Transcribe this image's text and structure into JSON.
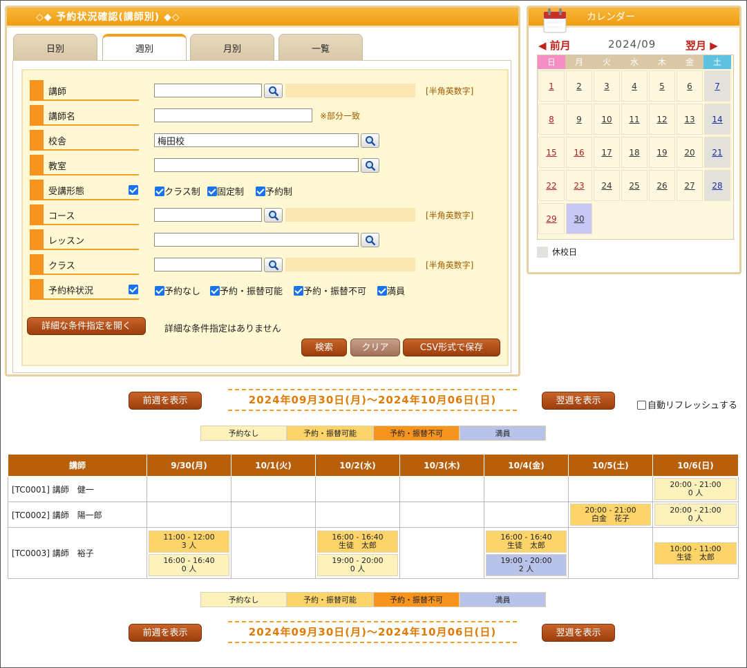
{
  "search": {
    "title": "◇◆ 予約状況確認(講師別) ◆◇",
    "tabs": [
      "日別",
      "週別",
      "月別",
      "一覧"
    ],
    "active_tab": "週別",
    "rows": {
      "teacher": {
        "label": "講師",
        "value": "",
        "hint": "[半角英数字]"
      },
      "teacher_name": {
        "label": "講師名",
        "value": "",
        "hint": "※部分一致"
      },
      "school": {
        "label": "校舎",
        "value": "梅田校"
      },
      "room": {
        "label": "教室",
        "value": ""
      },
      "attend_type": {
        "label": "受講形態",
        "options": [
          "クラス制",
          "固定制",
          "予約制"
        ]
      },
      "course": {
        "label": "コース",
        "value": "",
        "hint": "[半角英数字]"
      },
      "lesson": {
        "label": "レッスン",
        "value": ""
      },
      "class": {
        "label": "クラス",
        "value": "",
        "hint": "[半角英数字]"
      },
      "slot_status": {
        "label": "予約枠状況",
        "options": [
          "予約なし",
          "予約・振替可能",
          "予約・振替不可",
          "満員"
        ]
      }
    },
    "detail_button": "詳細な条件指定を開く",
    "detail_note": "詳細な条件指定はありません",
    "buttons": {
      "search": "検索",
      "clear": "クリア",
      "csv": "CSV形式で保存"
    }
  },
  "calendar": {
    "title": "カレンダー",
    "prev": "前月",
    "next": "翌月",
    "month": "2024/09",
    "dow": [
      "日",
      "月",
      "火",
      "水",
      "木",
      "金",
      "土"
    ],
    "dow_colors": [
      "#f58fc3",
      "#d9c7a5",
      "#d9c7a5",
      "#d9c7a5",
      "#d9c7a5",
      "#d9c7a5",
      "#5fc2e0"
    ],
    "days": [
      "1",
      "2",
      "3",
      "4",
      "5",
      "6",
      "7",
      "8",
      "9",
      "10",
      "11",
      "12",
      "13",
      "14",
      "15",
      "16",
      "17",
      "18",
      "19",
      "20",
      "21",
      "22",
      "23",
      "24",
      "25",
      "26",
      "27",
      "28",
      "29",
      "30"
    ],
    "red_days": [
      "1",
      "8",
      "15",
      "16",
      "22",
      "23",
      "29"
    ],
    "today": "30",
    "legend": "休校日"
  },
  "week": {
    "prev_button": "前週を表示",
    "next_button": "翌週を表示",
    "range": "2024年09月30日(月)～2024年10月06日(日)",
    "auto_refresh": "自動リフレッシュする"
  },
  "legend": [
    {
      "label": "予約なし",
      "color": "#fdf2bc"
    },
    {
      "label": "予約・振替可能",
      "color": "#fdd46a"
    },
    {
      "label": "予約・振替不可",
      "color": "#f7941e"
    },
    {
      "label": "満員",
      "color": "#b8c3ea"
    }
  ],
  "schedule": {
    "headers": [
      "講師",
      "9/30(月)",
      "10/1(火)",
      "10/2(水)",
      "10/3(木)",
      "10/4(金)",
      "10/5(土)",
      "10/6(日)"
    ],
    "rows": [
      {
        "teacher": "[TC0001] 講師　健一",
        "cells": [
          [],
          [],
          [],
          [],
          [],
          [],
          [
            {
              "time": "20:00 - 21:00",
              "info": "0 人",
              "status": "none"
            }
          ]
        ]
      },
      {
        "teacher": "[TC0002] 講師　陽一郎",
        "cells": [
          [],
          [],
          [],
          [],
          [],
          [
            {
              "time": "20:00 - 21:00",
              "info": "白金　花子",
              "status": "ok"
            }
          ],
          [
            {
              "time": "20:00 - 21:00",
              "info": "0 人",
              "status": "none"
            }
          ]
        ]
      },
      {
        "teacher": "[TC0003] 講師　裕子",
        "cells": [
          [
            {
              "time": "11:00 - 12:00",
              "info": "3 人",
              "status": "ok"
            },
            {
              "time": "16:00 - 16:40",
              "info": "0 人",
              "status": "none"
            }
          ],
          [],
          [
            {
              "time": "16:00 - 16:40",
              "info": "生徒　太郎",
              "status": "ok"
            },
            {
              "time": "19:00 - 20:00",
              "info": "0 人",
              "status": "none"
            }
          ],
          [],
          [
            {
              "time": "16:00 - 16:40",
              "info": "生徒　太郎",
              "status": "ok"
            },
            {
              "time": "19:00 - 20:00",
              "info": "2 人",
              "status": "full"
            }
          ],
          [],
          [
            {
              "time": "10:00 - 11:00",
              "info": "生徒　太郎",
              "status": "ok"
            }
          ]
        ]
      }
    ]
  }
}
